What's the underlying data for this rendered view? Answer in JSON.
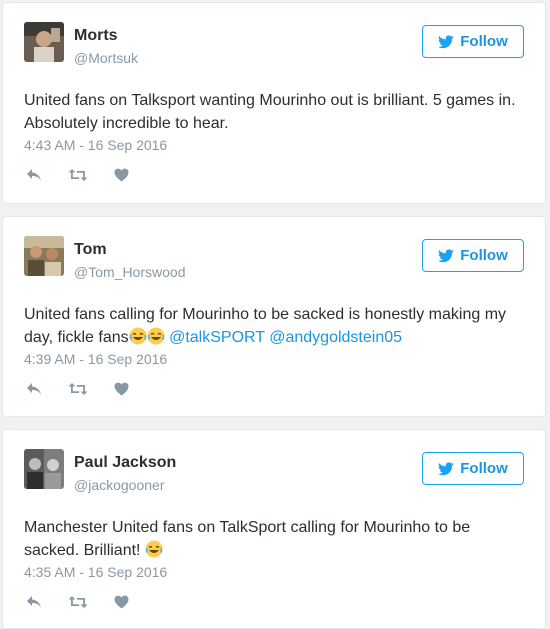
{
  "colors": {
    "link": "#1b95e0",
    "muted": "#8899a6",
    "text": "#292f33",
    "follow_border": "#1da1f2"
  },
  "tweets": [
    {
      "name": "Morts",
      "handle": "@Mortsuk",
      "follow_label": "Follow",
      "text": "United fans on Talksport wanting Mourinho out is brilliant. 5 games in. Absolutely incredible to hear.",
      "timestamp": "4:43 AM - 16 Sep 2016",
      "avatar_icon": "profile-photo"
    },
    {
      "name": "Tom",
      "handle": "@Tom_Horswood",
      "follow_label": "Follow",
      "text": "United fans calling for Mourinho to be sacked is honestly making my day, fickle fans",
      "mentions": [
        "@talkSPORT",
        "@andygoldstein05"
      ],
      "emoji": "face-with-tears-of-joy x2",
      "timestamp": "4:39 AM - 16 Sep 2016",
      "avatar_icon": "profile-photo"
    },
    {
      "name": "Paul Jackson",
      "handle": "@jackogooner",
      "follow_label": "Follow",
      "text": "Manchester United fans on TalkSport calling for Mourinho to be sacked. Brilliant!",
      "emoji": "face-with-tears-of-joy",
      "timestamp": "4:35 AM - 16 Sep 2016",
      "avatar_icon": "profile-photo"
    }
  ],
  "action_icons": [
    "reply-icon",
    "retweet-icon",
    "like-icon"
  ]
}
